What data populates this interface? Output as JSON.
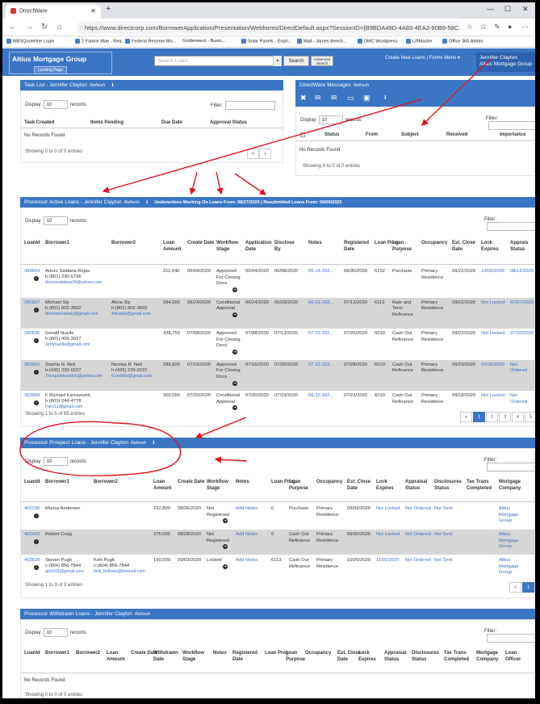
{
  "browser": {
    "tab_title": "DirectWare",
    "url": "https://www.directcorp.com/BorrowerApplication/Presentation/Webforms/DirectDefault.aspx?SessionID={B9BDA49D-4A83-4EA2-90B9-58C..."
  },
  "bookmarks": [
    "MBSQuoteline Login",
    "2 Fannie Mae - Req...",
    "Federal Reserve Mo...",
    "Goldenwest - Busin...",
    "Solar Panels - Enph...",
    "Mail - James Beech...",
    "DMC Wordpress",
    "LiftMaster",
    "Office 365 Admin"
  ],
  "header": {
    "brand": "Altius Mortgage Group",
    "landing": "Landing Page",
    "search_placeholder": "Search Loans",
    "search_btn": "Search",
    "adv_btn": "Advanced Search",
    "create_menu": "Create New Loans | Forms Menu ▾",
    "user_name": "Jennifer Clayton",
    "user_company": "Altius Mortgage Group"
  },
  "common": {
    "display": "Display",
    "records": "records",
    "filter": "Filter:",
    "refresh": "Refresh",
    "page_size": "10"
  },
  "task": {
    "title": "Task List - Jennifer Clayton",
    "cols": [
      "Task Created",
      "Items Pending",
      "Due Date",
      "Approval Status"
    ],
    "empty": "No Records Found",
    "showing": "Showing 0 to 0 of 0 entries"
  },
  "messages": {
    "title": "DirectWare Messages",
    "cols": [
      "Status",
      "From",
      "Subject",
      "Received",
      "Importance"
    ],
    "empty": "No Records Found",
    "showing": "Showing 0 to 0 of 0 entries"
  },
  "active": {
    "title": "Processor Active Loans - Jennifer Clayton",
    "underwriters": "Underwriters Working On Loans From: 08/27/2020 | Resubmitted Loans From: 09/09/2020",
    "cols": [
      "LoanId",
      "Borrower1",
      "Borrower2",
      "Loan Amount",
      "Create Date",
      "Workflow Stage",
      "Application Date",
      "Disclose By",
      "Notes",
      "Registered Date",
      "Loan Prog",
      "Loan Purpose",
      "Occupancy",
      "Est. Close Date",
      "Lock Expires",
      "Apprais Status"
    ],
    "rows": [
      {
        "id": "386604",
        "b1": "Arturo Saldana Rojas",
        "b1p": "h:(801) 230-6736",
        "b1e": "Arturosaldana24@yahoo.com",
        "b2": "",
        "b2p": "",
        "b2e": "",
        "amt": "211,640",
        "cd": "06/04/2020",
        "wf": "Approved For Closing Docs",
        "ad": "06/04/2020",
        "db": "06/08/2020",
        "notes": "06-14-202...",
        "rd": "06/30/2020",
        "prog": "6152",
        "purpose": "Purchase",
        "occ": "Primary Residence",
        "ecd": "09/22/2020",
        "lock": "10/05/2020",
        "appr": "08/12/2020"
      },
      {
        "id": "386507",
        "b1": "Michael Sly",
        "b1p": "h:(801) 602-3602",
        "b1e": "Michaelclarksly@gmail.com",
        "b2": "Alicia Sly",
        "b2p": "h:(801) 602-3602",
        "b2e": "Aliciasly@gmail.com",
        "amt": "284,000",
        "cd": "06/24/2020",
        "wf": "Conditional Approval",
        "ad": "06/24/2020",
        "db": "06/29/2020",
        "notes": "06-21-202...",
        "rd": "07/13/2020",
        "prog": "6113",
        "purpose": "Rate and Term Refinance",
        "occ": "Primary Residence",
        "ecd": "09/22/2020",
        "lock": "Not Locked",
        "appr": "07/07/2020"
      },
      {
        "id": "390635",
        "b1": "Gerald Nuelle",
        "b1p": "h:(801) 455-3027",
        "b1e": "Jerrynuelle@gmail.com",
        "b2": "",
        "b2p": "",
        "b2e": "",
        "amt": "438,750",
        "cd": "07/08/2020",
        "wf": "Approved For Closing Docs",
        "ad": "07/08/2020",
        "db": "07/13/2020",
        "notes": "07-22-202...",
        "rd": "07/20/2020",
        "prog": "6010",
        "purpose": "Cash Out Refinance",
        "occ": "Primary Residence",
        "ecd": "09/22/2020",
        "lock": "Not Locked",
        "appr": "07/10/2020"
      },
      {
        "id": "393660",
        "b1": "Sophia N. Neil",
        "b1p": "h:(435) 229-0237",
        "b1e": "Thesparklewithin@yahoo.com",
        "b2": "Nicolas R. Neil",
        "b2p": "h:(435) 229-0237",
        "b2e": "N.neilttle@gmail.com",
        "amt": "286,600",
        "cd": "07/16/2020",
        "wf": "Approved For Closing Docs",
        "ad": "07/16/2020",
        "db": "07/20/2020",
        "notes": "07-22-202...",
        "rd": "07/28/2020",
        "prog": "6010",
        "purpose": "Cash Out Refinance",
        "occ": "Primary Residence",
        "ecd": "09/23/2020",
        "lock": "09/28/2020",
        "appr": "Not Ordered"
      },
      {
        "id": "393969",
        "b1": "F Richard Farnsworth",
        "b1p": "h:(801) 244-4778",
        "b1e": "Farn12@gmail.com",
        "b2": "",
        "b2p": "",
        "b2e": "",
        "amt": "300,000",
        "cd": "07/20/2020",
        "wf": "Conditional Approval",
        "ad": "07/20/2020",
        "db": "07/23/2020",
        "notes": "06-15-202...",
        "rd": "07/23/2020",
        "prog": "6010",
        "purpose": "Cash Out Refinance",
        "occ": "Primary Residence",
        "ecd": "09/18/2020",
        "lock": "Not Locked",
        "appr": "Not Ordered"
      }
    ],
    "showing": "Showing 1 to 5 of 65 entries",
    "pages": [
      "«",
      "1",
      "2",
      "3",
      "4",
      "5"
    ]
  },
  "prospect": {
    "title": "Processor Prospect Loans - Jennifer Clayton",
    "cols": [
      "LoanId",
      "Borrower1",
      "Borrower2",
      "Loan Amount",
      "Create Date",
      "Workflow Stage",
      "Notes",
      "Loan Prog",
      "Loan Purpose",
      "Occupancy",
      "Est. Close Date",
      "Lock Expires",
      "Appraisal Status",
      "Disclosures Status",
      "Tax Trans Completed",
      "Mortgage Company"
    ],
    "rows": [
      {
        "id": "402230",
        "b1": "Morisa Andersen",
        "b1p": "",
        "b1e": "",
        "b2": "",
        "b2p": "",
        "b2e": "",
        "amt": "232,800",
        "cd": "08/26/2020",
        "wf": "Not Registered",
        "notes": "Add Notes",
        "prog": "0",
        "purpose": "Purchase",
        "occ": "Primary Residence",
        "ecd": "09/09/2020",
        "lock": "Not Locked",
        "appr": "Not Ordered",
        "disc": "Not Sent",
        "tax": "",
        "mc": "Altius Mortgage Group"
      },
      {
        "id": "402425",
        "b1": "Robert Craig",
        "b1p": "",
        "b1e": "",
        "b2": "",
        "b2p": "",
        "b2e": "",
        "amt": "275,000",
        "cd": "08/28/2020",
        "wf": "Not Registered",
        "notes": "Add Notes",
        "prog": "0",
        "purpose": "Cash Out Refinance",
        "occ": "Primary Residence",
        "ecd": "09/30/2020",
        "lock": "Not Locked",
        "appr": "Not Ordered",
        "disc": "Not Sent",
        "tax": "",
        "mc": "Altius Mortgage Group"
      },
      {
        "id": "403620",
        "b1": "Steven Pugh",
        "b1p": "c:(804) 856-7844",
        "b1e": "girlz911@gmail.com",
        "b2": "Kelli Pugh",
        "b2p": "c:(804) 856-7844",
        "b2e": "kelli_bellows@hotmail.com",
        "amt": "190,000",
        "cd": "09/03/2020",
        "wf": "Locked",
        "notes": "Add Notes",
        "prog": "6113",
        "purpose": "Cash Out Refinance",
        "occ": "Primary Residence",
        "ecd": "10/26/2020",
        "lock": "11/02/2020",
        "appr": "Not Ordered",
        "disc": "Not Sent",
        "tax": "",
        "mc": "Altius Mortgage Group"
      }
    ],
    "showing": "Showing 1 to 3 of 3 entries",
    "pages": [
      "«",
      "1"
    ]
  },
  "withdrawn": {
    "title": "Processor Withdrawn Loans - Jennifer Clayton",
    "cols": [
      "LoanId",
      "Borrower1",
      "Borrower2",
      "Loan Amount",
      "Create Date",
      "Withdrawn Date",
      "Workflow Stage",
      "Notes",
      "Registered Date",
      "Loan Prog",
      "Loan Purpose",
      "Occupancy",
      "Est. Close Date",
      "Lock Expires",
      "Appraisal Status",
      "Disclosures Status",
      "Tax Trans Completed",
      "Mortgage Company",
      "Loan Officer"
    ],
    "empty": "No Records Found",
    "showing": "Showing 0 to 0 of 0 entries"
  },
  "colors": {
    "header_blue": "#3a76c4",
    "link": "#3a6fc4",
    "annotation_red": "#e0141e"
  }
}
